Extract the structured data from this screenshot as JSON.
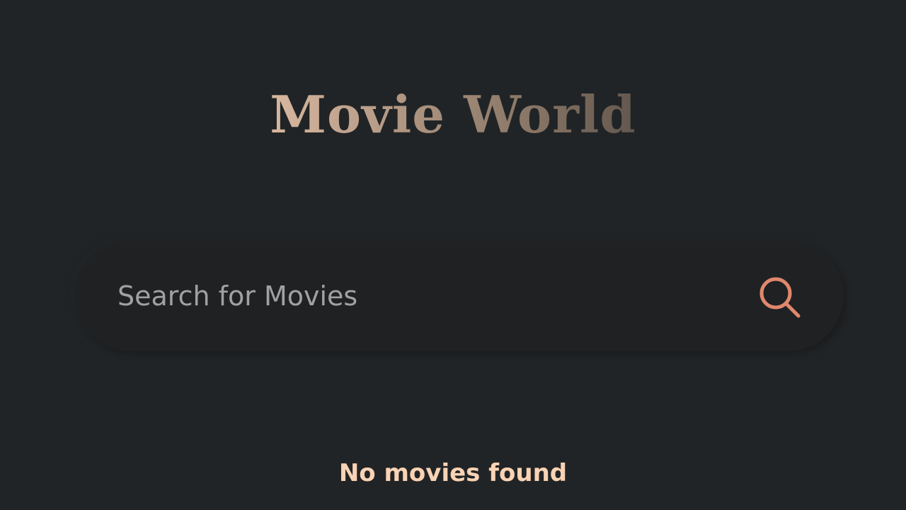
{
  "app": {
    "title": "Movie World"
  },
  "search": {
    "placeholder": "Search for Movies",
    "value": "",
    "icon": "search-icon"
  },
  "results": {
    "empty_message": "No movies found"
  },
  "colors": {
    "background": "#212426",
    "accent": "#f9d3b4",
    "search_icon": "#e0886c",
    "placeholder": "#a1a1a1"
  }
}
